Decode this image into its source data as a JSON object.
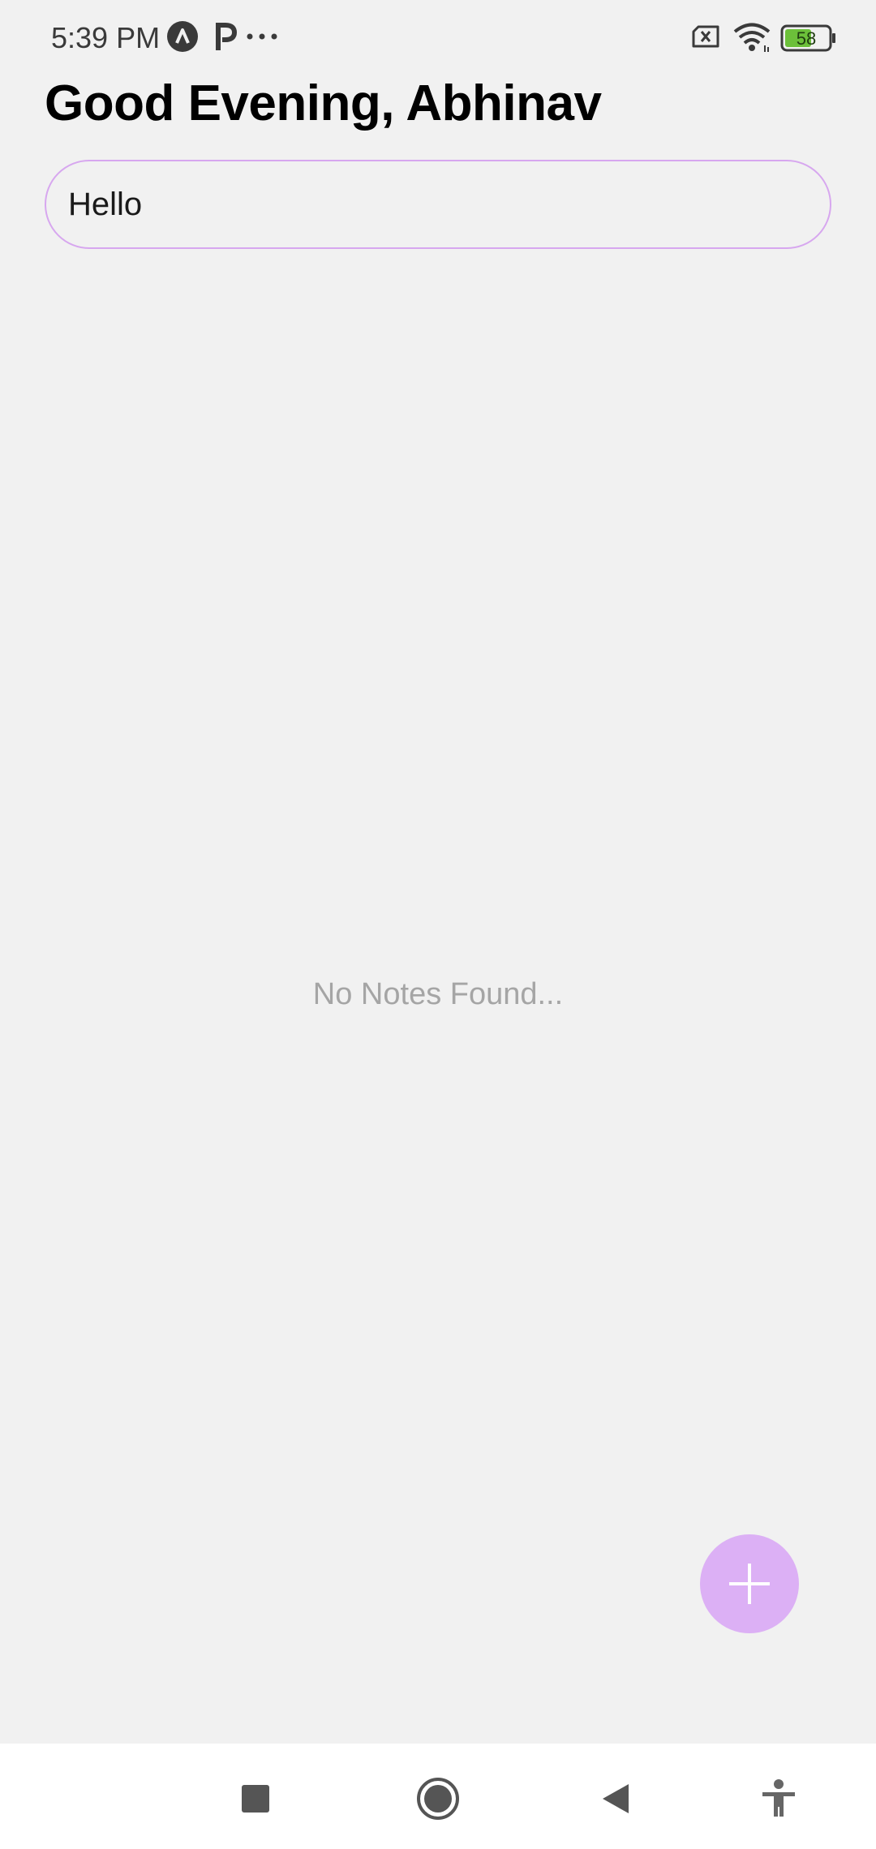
{
  "status_bar": {
    "time": "5:39 PM",
    "battery_level": "58",
    "icons": [
      "app-a-icon",
      "app-p-icon",
      "more-dots-icon",
      "no-sim-icon",
      "wifi-icon",
      "battery-icon"
    ]
  },
  "header": {
    "greeting": "Good Evening, Abhinav"
  },
  "search": {
    "value": "Hello",
    "placeholder": ""
  },
  "empty_state": {
    "message": "No Notes Found..."
  },
  "fab": {
    "icon": "plus-icon",
    "color": "#dcb0f5"
  },
  "nav": {
    "items": [
      "recents-square-icon",
      "home-circle-icon",
      "back-triangle-icon",
      "accessibility-icon"
    ]
  },
  "colors": {
    "background": "#f1f1f1",
    "accent": "#dcb0f5",
    "input_border": "#d7a7ef"
  }
}
